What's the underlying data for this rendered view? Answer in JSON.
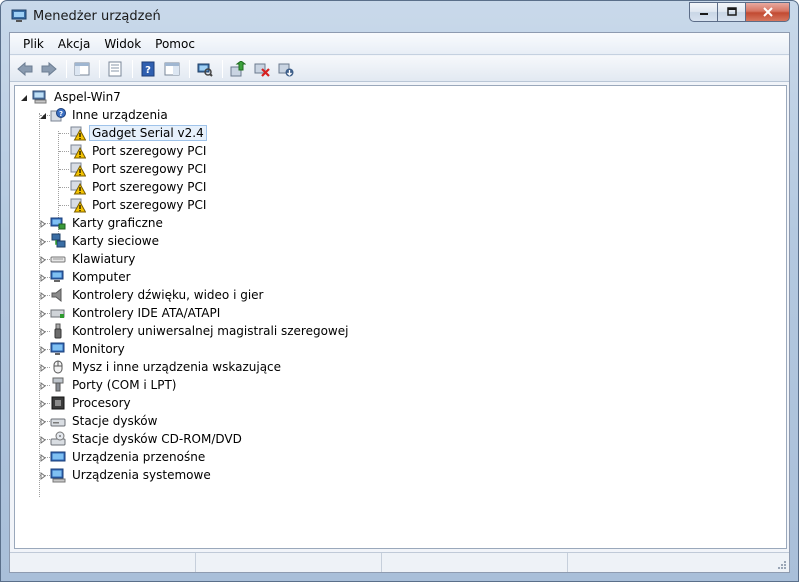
{
  "window": {
    "title": "Menedżer urządzeń",
    "caption_buttons": [
      "minimize",
      "maximize",
      "close"
    ],
    "accent_color": "#c24a32"
  },
  "menu": [
    "Plik",
    "Akcja",
    "Widok",
    "Pomoc"
  ],
  "toolbar": {
    "buttons": [
      {
        "icon": "back-arrow-icon"
      },
      {
        "icon": "forward-arrow-icon"
      },
      {
        "icon": "show-hide-tree-icon"
      },
      {
        "icon": "properties-icon"
      },
      {
        "icon": "help-icon"
      },
      {
        "icon": "view-icon"
      },
      {
        "icon": "scan-hardware-icon"
      },
      {
        "icon": "update-driver-icon"
      },
      {
        "icon": "uninstall-icon"
      },
      {
        "icon": "disable-device-icon"
      }
    ]
  },
  "tree": {
    "root": "Aspel-Win7",
    "other_devices": {
      "label": "Inne urządzenia",
      "children": [
        "Gadget Serial v2.4",
        "Port szeregowy PCI",
        "Port szeregowy PCI",
        "Port szeregowy PCI",
        "Port szeregowy PCI"
      ],
      "selected_index": 0
    },
    "categories": [
      {
        "label": "Karty graficzne",
        "icon": "display-adapter-icon"
      },
      {
        "label": "Karty sieciowe",
        "icon": "network-adapter-icon"
      },
      {
        "label": "Klawiatury",
        "icon": "keyboard-icon"
      },
      {
        "label": "Komputer",
        "icon": "computer-icon"
      },
      {
        "label": "Kontrolery dźwięku, wideo i gier",
        "icon": "speaker-icon"
      },
      {
        "label": "Kontrolery IDE ATA/ATAPI",
        "icon": "ide-controller-icon"
      },
      {
        "label": "Kontrolery uniwersalnej magistrali szeregowej",
        "icon": "usb-icon"
      },
      {
        "label": "Monitory",
        "icon": "monitor-icon"
      },
      {
        "label": "Mysz i inne urządzenia wskazujące",
        "icon": "mouse-icon"
      },
      {
        "label": "Porty (COM i LPT)",
        "icon": "port-icon"
      },
      {
        "label": "Procesory",
        "icon": "processor-icon"
      },
      {
        "label": "Stacje dysków",
        "icon": "disk-drive-icon"
      },
      {
        "label": "Stacje dysków CD-ROM/DVD",
        "icon": "cdrom-icon"
      },
      {
        "label": "Urządzenia przenośne",
        "icon": "portable-device-icon"
      },
      {
        "label": "Urządzenia systemowe",
        "icon": "system-device-icon"
      }
    ]
  }
}
